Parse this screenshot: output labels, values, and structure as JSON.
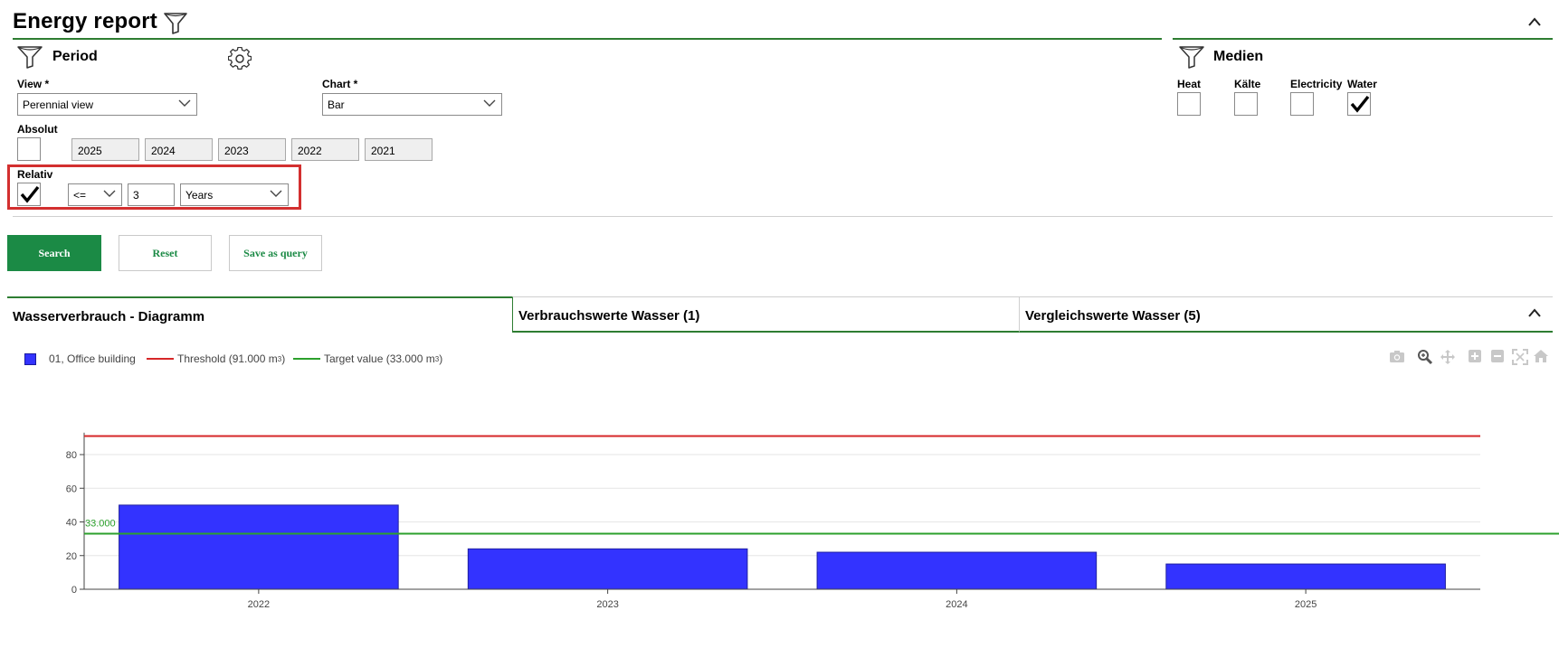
{
  "header": {
    "title": "Energy report"
  },
  "period": {
    "title": "Period",
    "view": {
      "label": "View *",
      "value": "Perennial view"
    },
    "chart": {
      "label": "Chart *",
      "value": "Bar"
    },
    "absolut": {
      "label": "Absolut",
      "checked": false,
      "years": [
        "2025",
        "2024",
        "2023",
        "2022",
        "2021"
      ]
    },
    "relativ": {
      "label": "Relativ",
      "checked": true,
      "operator": "<=",
      "amount": "3",
      "unit": "Years"
    }
  },
  "medien": {
    "title": "Medien",
    "items": [
      {
        "label": "Heat",
        "checked": false
      },
      {
        "label": "Kälte",
        "checked": false
      },
      {
        "label": "Electricity",
        "checked": false
      },
      {
        "label": "Water",
        "checked": true
      }
    ]
  },
  "buttons": {
    "search": "Search",
    "reset": "Reset",
    "save": "Save as query"
  },
  "tabs": [
    {
      "label": "Wasserverbrauch - Diagramm"
    },
    {
      "label": "Verbrauchswerte Wasser (1)"
    },
    {
      "label": "Vergleichswerte Wasser (5)"
    }
  ],
  "legend": {
    "series": "01, Office building",
    "threshold": "Threshold (91.000 m",
    "target": "Target value (33.000 m",
    "unit_sup": "3",
    "close_paren": ")"
  },
  "colors": {
    "accent": "#1b8a45",
    "bar": "#3333ff",
    "threshold": "#d62728",
    "target": "#2ca02c",
    "highlight": "#d32f2f"
  },
  "chart_data": {
    "type": "bar",
    "categories": [
      "2022",
      "2023",
      "2024",
      "2025"
    ],
    "series": [
      {
        "name": "01, Office building",
        "values": [
          50,
          24,
          22,
          15
        ]
      }
    ],
    "threshold": 91,
    "target": 33,
    "target_label": "33.000",
    "ylim": [
      0,
      93
    ],
    "yticks": [
      0,
      20,
      40,
      60,
      80
    ],
    "grid": true,
    "legend_position": "top-left"
  }
}
